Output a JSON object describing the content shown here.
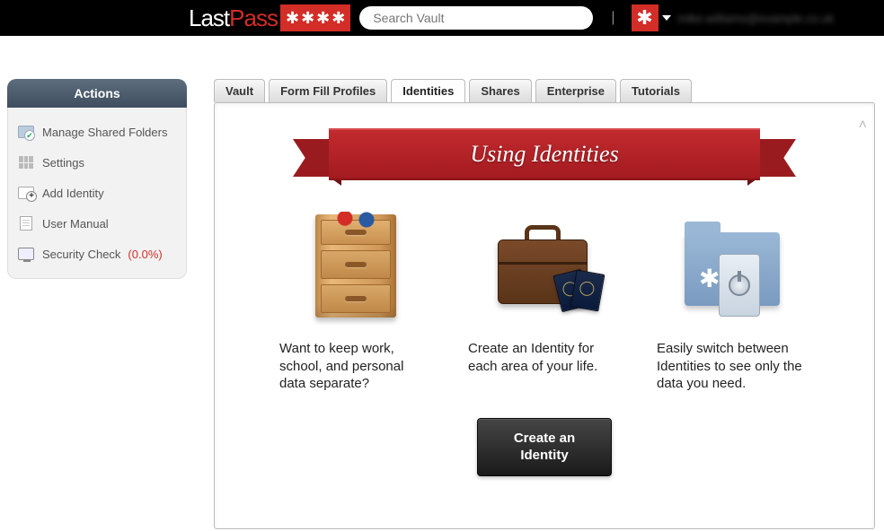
{
  "header": {
    "logo_last": "Last",
    "logo_pass": "Pass",
    "search_placeholder": "Search Vault",
    "user_email": "mike.williams@example.co.uk"
  },
  "sidebar": {
    "title": "Actions",
    "items": [
      {
        "label": "Manage Shared Folders"
      },
      {
        "label": "Settings"
      },
      {
        "label": "Add Identity"
      },
      {
        "label": "User Manual"
      },
      {
        "label": "Security Check",
        "pct": "(0.0%)"
      }
    ]
  },
  "tabs": [
    {
      "label": "Vault"
    },
    {
      "label": "Form Fill Profiles"
    },
    {
      "label": "Identities",
      "active": true
    },
    {
      "label": "Shares"
    },
    {
      "label": "Enterprise"
    },
    {
      "label": "Tutorials"
    }
  ],
  "panel": {
    "ribbon_title": "Using Identities",
    "features": [
      {
        "text": "Want to keep work, school, and personal data separate?"
      },
      {
        "text": "Create an Identity for each area of your life."
      },
      {
        "text": "Easily switch between Identities to see only the data you need."
      }
    ],
    "cta_line1": "Create an",
    "cta_line2": "Identity"
  }
}
